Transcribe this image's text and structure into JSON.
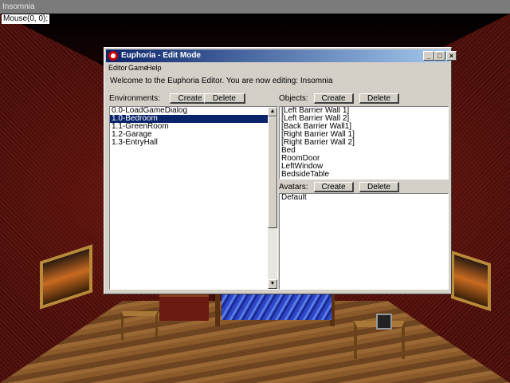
{
  "window": {
    "title": "Insomnia"
  },
  "mouse_readout": "Mouse(0, 0);",
  "dialog": {
    "title": "Euphoria - Edit Mode",
    "menu": [
      "Editor",
      "Game",
      "Help"
    ],
    "welcome": "Welcome to the Euphoria Editor. You are now editing: Insomnia",
    "environments": {
      "label": "Environments:",
      "create_label": "Create",
      "delete_label": "Delete",
      "items": [
        "0.0-LoadGameDialog",
        "1.0-Bedroom",
        "1.1-GreenRoom",
        "1.2-Garage",
        "1.3-EntryHall"
      ],
      "selected": "1.0-Bedroom"
    },
    "objects": {
      "label": "Objects:",
      "create_label": "Create",
      "delete_label": "Delete",
      "items": [
        "[Left Barrier Wall 1]",
        "[Left Barrier Wall 2]",
        "[Back Barrier Wall1]",
        "[Right Barrier Wall 1]",
        "[Right Barrier Wall 2]",
        "Bed",
        "RoomDoor",
        "LeftWindow",
        "BedsideTable"
      ]
    },
    "avatars": {
      "label": "Avatars:",
      "create_label": "Create",
      "delete_label": "Delete",
      "items": [
        "Default"
      ]
    }
  },
  "colors": {
    "title_bar_start": "#0a246a",
    "title_bar_end": "#a6caf0",
    "dialog_face": "#d4d0c8",
    "selection": "#0a246a"
  },
  "icons": {
    "app": "euphoria-app-icon",
    "minimize": "minimize-icon",
    "maximize": "maximize-icon",
    "close": "close-icon"
  }
}
